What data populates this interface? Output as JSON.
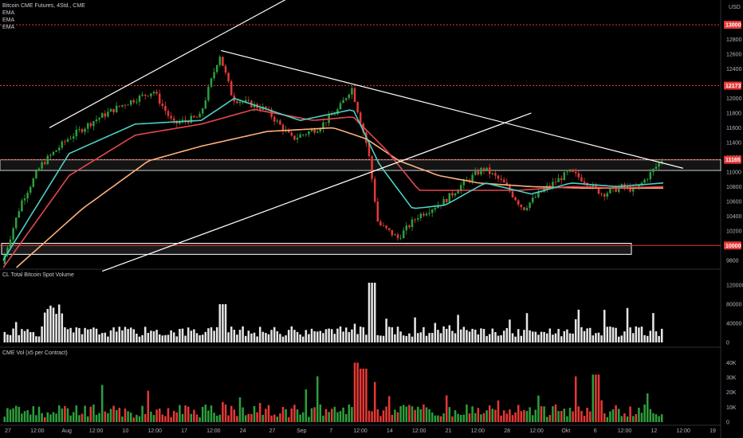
{
  "header": {
    "symbol_line": "Bitcoin CME Futures, 4Std., CME",
    "indicators": [
      "EMA",
      "EMA",
      "EMA"
    ],
    "currency": "USD"
  },
  "panes": {
    "volume_title": "CL Total Bitcoin Spot Volume",
    "cme_title": "CME Vol (x5 per Contract)"
  },
  "colors": {
    "background": "#000000",
    "up": "#2e9e3c",
    "down": "#e53935",
    "ema_fast": "#4dd0c4",
    "ema_mid": "#e5484d",
    "ema_slow": "#ffb07c",
    "level_line": "#e53935",
    "trendline": "#ffffff",
    "volume_bar": "#e6e6e6",
    "axis_text": "#b2b5be"
  },
  "price_labels": [
    {
      "value": 13000,
      "text": "13000",
      "style": "red"
    },
    {
      "value": 12173,
      "text": "12173",
      "style": "red"
    },
    {
      "value": 11165,
      "text": "11165",
      "style": "red"
    },
    {
      "value": 10000,
      "text": "10000",
      "style": "red"
    }
  ],
  "chart_data": [
    {
      "type": "candlestick",
      "title": "Bitcoin CME Futures, 4Std., CME",
      "x_ticks": [
        "27",
        "12:00",
        "Aug",
        "12:00",
        "10",
        "12:00",
        "17",
        "12:00",
        "24",
        "27",
        "Sep",
        "7",
        "12:00",
        "14",
        "12:00",
        "21",
        "12:00",
        "28",
        "12:00",
        "Okt",
        "6",
        "12:00",
        "12",
        "12:00",
        "19"
      ],
      "y_ticks": [
        9800,
        10000,
        10200,
        10400,
        10600,
        10800,
        11000,
        11200,
        11400,
        11600,
        11800,
        12000,
        12200,
        12400,
        12600,
        12800,
        13000
      ],
      "ylim": [
        9700,
        13250
      ],
      "y_unit": "USD",
      "key_points": [
        {
          "x": 0.0,
          "y": 9750
        },
        {
          "x": 0.03,
          "y": 10600
        },
        {
          "x": 0.06,
          "y": 11100
        },
        {
          "x": 0.1,
          "y": 11450
        },
        {
          "x": 0.14,
          "y": 11700
        },
        {
          "x": 0.18,
          "y": 11900
        },
        {
          "x": 0.23,
          "y": 12100
        },
        {
          "x": 0.26,
          "y": 11650
        },
        {
          "x": 0.3,
          "y": 11750
        },
        {
          "x": 0.33,
          "y": 12600
        },
        {
          "x": 0.35,
          "y": 12000
        },
        {
          "x": 0.4,
          "y": 11850
        },
        {
          "x": 0.44,
          "y": 11450
        },
        {
          "x": 0.48,
          "y": 11600
        },
        {
          "x": 0.51,
          "y": 11850
        },
        {
          "x": 0.53,
          "y": 12150
        },
        {
          "x": 0.555,
          "y": 11300
        },
        {
          "x": 0.57,
          "y": 10300
        },
        {
          "x": 0.6,
          "y": 10100
        },
        {
          "x": 0.63,
          "y": 10400
        },
        {
          "x": 0.67,
          "y": 10600
        },
        {
          "x": 0.7,
          "y": 10850
        },
        {
          "x": 0.73,
          "y": 11050
        },
        {
          "x": 0.76,
          "y": 10850
        },
        {
          "x": 0.79,
          "y": 10500
        },
        {
          "x": 0.82,
          "y": 10750
        },
        {
          "x": 0.86,
          "y": 11000
        },
        {
          "x": 0.88,
          "y": 10900
        },
        {
          "x": 0.91,
          "y": 10700
        },
        {
          "x": 0.94,
          "y": 10800
        },
        {
          "x": 0.96,
          "y": 10750
        },
        {
          "x": 0.98,
          "y": 10950
        },
        {
          "x": 1.0,
          "y": 11165
        }
      ],
      "ema_key_points": {
        "fast": [
          {
            "x": 0.0,
            "y": 9800
          },
          {
            "x": 0.1,
            "y": 11250
          },
          {
            "x": 0.2,
            "y": 11650
          },
          {
            "x": 0.3,
            "y": 11700
          },
          {
            "x": 0.35,
            "y": 12000
          },
          {
            "x": 0.45,
            "y": 11700
          },
          {
            "x": 0.53,
            "y": 11850
          },
          {
            "x": 0.57,
            "y": 11100
          },
          {
            "x": 0.62,
            "y": 10500
          },
          {
            "x": 0.67,
            "y": 10550
          },
          {
            "x": 0.73,
            "y": 10850
          },
          {
            "x": 0.8,
            "y": 10700
          },
          {
            "x": 0.86,
            "y": 10850
          },
          {
            "x": 0.93,
            "y": 10800
          },
          {
            "x": 1.0,
            "y": 10850
          }
        ],
        "mid": [
          {
            "x": 0.0,
            "y": 9700
          },
          {
            "x": 0.1,
            "y": 10950
          },
          {
            "x": 0.2,
            "y": 11500
          },
          {
            "x": 0.3,
            "y": 11650
          },
          {
            "x": 0.38,
            "y": 11850
          },
          {
            "x": 0.47,
            "y": 11700
          },
          {
            "x": 0.53,
            "y": 11750
          },
          {
            "x": 0.58,
            "y": 11300
          },
          {
            "x": 0.63,
            "y": 10750
          },
          {
            "x": 0.7,
            "y": 10750
          },
          {
            "x": 0.78,
            "y": 10750
          },
          {
            "x": 0.86,
            "y": 10800
          },
          {
            "x": 0.93,
            "y": 10780
          },
          {
            "x": 1.0,
            "y": 10800
          }
        ],
        "slow": [
          {
            "x": 0.02,
            "y": 9700
          },
          {
            "x": 0.12,
            "y": 10500
          },
          {
            "x": 0.22,
            "y": 11150
          },
          {
            "x": 0.3,
            "y": 11350
          },
          {
            "x": 0.4,
            "y": 11550
          },
          {
            "x": 0.5,
            "y": 11600
          },
          {
            "x": 0.55,
            "y": 11450
          },
          {
            "x": 0.6,
            "y": 11150
          },
          {
            "x": 0.66,
            "y": 10950
          },
          {
            "x": 0.72,
            "y": 10850
          },
          {
            "x": 0.8,
            "y": 10800
          },
          {
            "x": 0.88,
            "y": 10780
          },
          {
            "x": 1.0,
            "y": 10780
          }
        ]
      },
      "zones": [
        {
          "from": 11020,
          "to": 11165,
          "kind": "horizontal-range"
        },
        {
          "from": 9880,
          "to": 10030,
          "kind": "support-box"
        }
      ]
    },
    {
      "type": "bar",
      "title": "CL Total Bitcoin Spot Volume",
      "y_ticks": [
        0,
        40000,
        80000,
        120000
      ],
      "ylim": [
        0,
        130000
      ]
    },
    {
      "type": "bar",
      "title": "CME Vol (x5 per Contract)",
      "y_ticks": [
        0,
        "10K",
        "20K",
        "30K",
        "40K"
      ],
      "ylim": [
        0,
        44000
      ]
    }
  ]
}
